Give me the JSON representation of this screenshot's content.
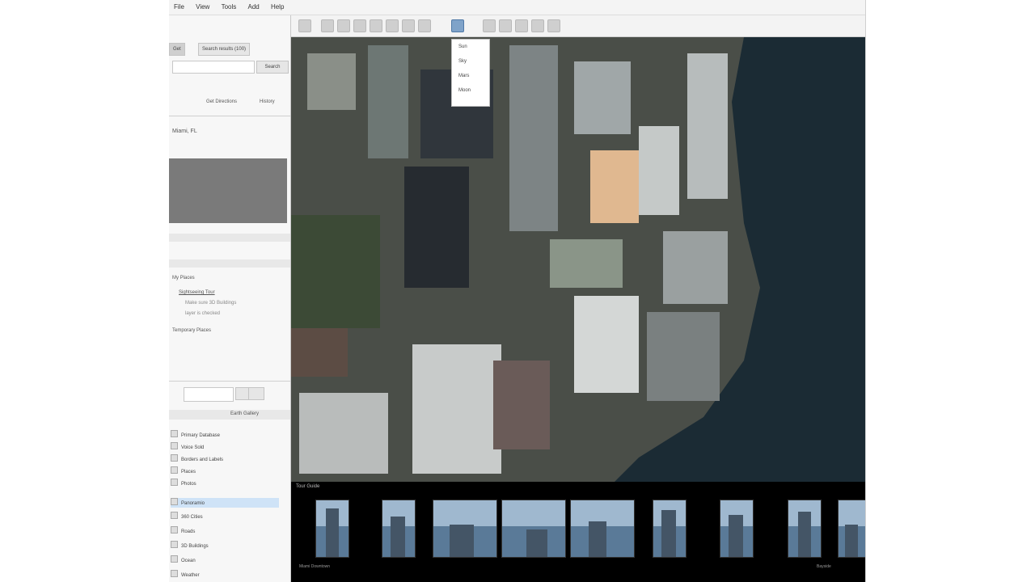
{
  "menu": [
    "File",
    "View",
    "Tools",
    "Add",
    "Help"
  ],
  "sidebar": {
    "tabs": [
      "Get",
      "Search results (100)"
    ],
    "search_value": "",
    "search_button": "Search",
    "links": [
      "Get Directions",
      "History"
    ],
    "location_text": "Miami, FL",
    "places_header": "My Places",
    "places": [
      "Sightseeing Tour",
      "Make sure 3D Buildings",
      "layer is checked",
      "Temporary Places"
    ],
    "layers_filter": "Earth Gallery",
    "layers": [
      "Primary Database",
      "Voice Sold",
      "Borders and Labels",
      "Places",
      "Photos",
      "Panoramio",
      "360 Cities",
      "Roads",
      "3D Buildings",
      "Ocean",
      "Weather"
    ]
  },
  "toolbar": {
    "active_tool": "sun-icon"
  },
  "dropdown": [
    "Sun",
    "Sky",
    "Mars",
    "Moon"
  ],
  "tour": {
    "title": "Tour Guide",
    "captions": [
      "Miami Downtown",
      "",
      "",
      "",
      "",
      "",
      "",
      "",
      "",
      "",
      "Bayside"
    ]
  },
  "colors": {
    "water": "#1b2b34",
    "selection": "#cfe3f7"
  }
}
